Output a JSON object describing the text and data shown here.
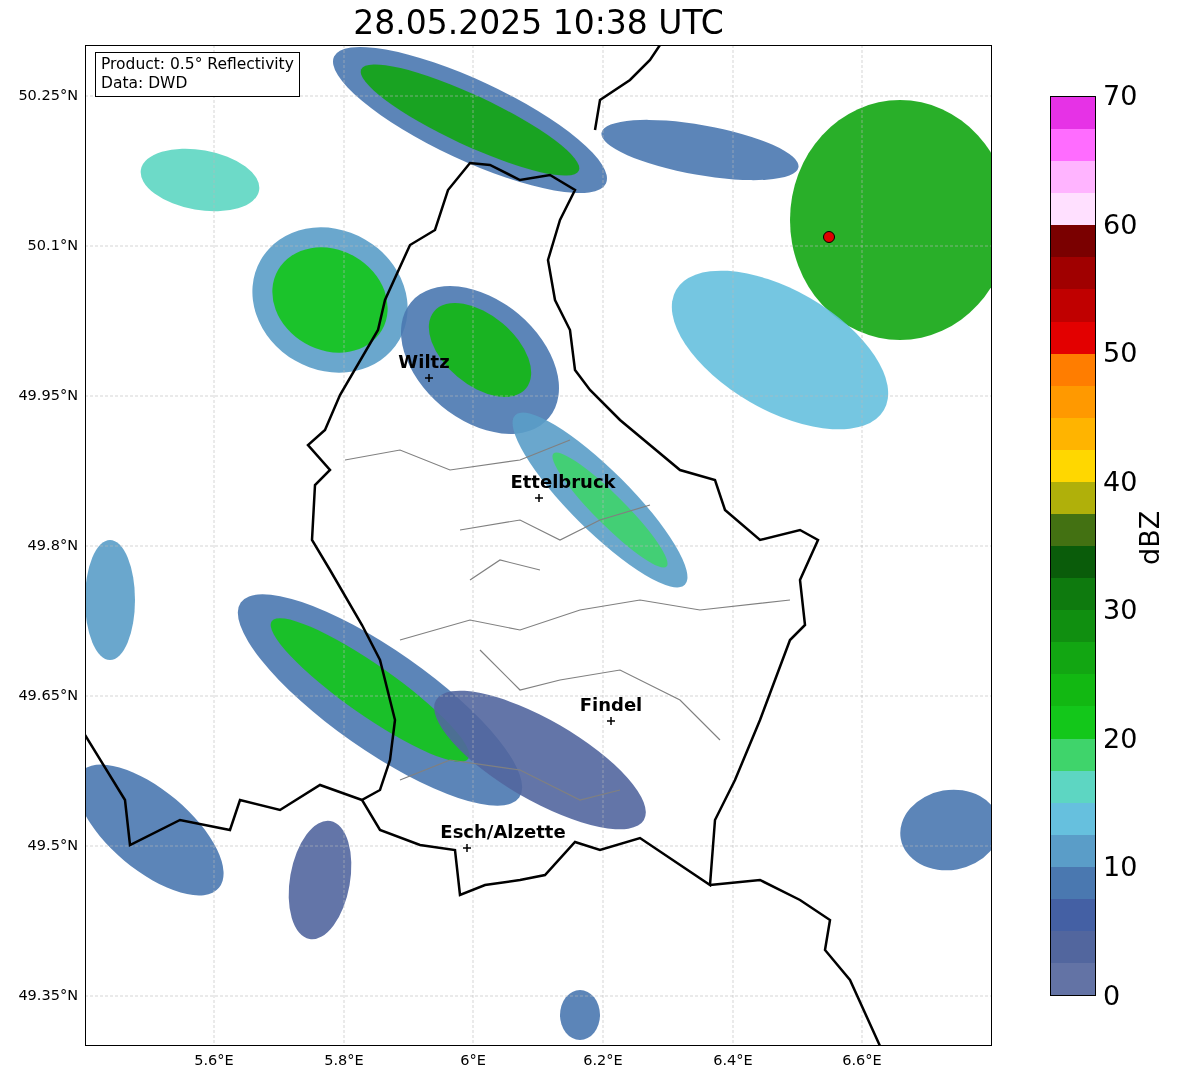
{
  "title": "28.05.2025 10:38 UTC",
  "info_box": [
    "Product: 0.5° Reflectivity",
    "Data: DWD"
  ],
  "map": {
    "y_ticks": [
      "50.25°N",
      "50.1°N",
      "49.95°N",
      "49.8°N",
      "49.65°N",
      "49.5°N",
      "49.35°N"
    ],
    "x_ticks": [
      "5.6°E",
      "5.8°E",
      "6°E",
      "6.2°E",
      "6.4°E",
      "6.6°E"
    ],
    "cities": [
      "Wiltz",
      "Ettelbruck",
      "Findel",
      "Esch/Alzette"
    ]
  },
  "colorbar": {
    "label": "dBZ",
    "ticks": [
      "70",
      "60",
      "50",
      "40",
      "30",
      "20",
      "10",
      "0"
    ],
    "bins": [
      {
        "color": "#e632e6"
      },
      {
        "color": "#ff6cff"
      },
      {
        "color": "#ffb4ff"
      },
      {
        "color": "#ffe0ff"
      },
      {
        "color": "#7a0000"
      },
      {
        "color": "#a00000"
      },
      {
        "color": "#c00000"
      },
      {
        "color": "#e30000"
      },
      {
        "color": "#ff7d00"
      },
      {
        "color": "#ff9900"
      },
      {
        "color": "#ffb400"
      },
      {
        "color": "#ffd700"
      },
      {
        "color": "#b0b00a"
      },
      {
        "color": "#437112"
      },
      {
        "color": "#0a5c0a"
      },
      {
        "color": "#0e7a0e"
      },
      {
        "color": "#108f10"
      },
      {
        "color": "#12a612"
      },
      {
        "color": "#12b812"
      },
      {
        "color": "#13c71a"
      },
      {
        "color": "#3fd46b"
      },
      {
        "color": "#5dd6c2"
      },
      {
        "color": "#66c0de"
      },
      {
        "color": "#5a9dc8"
      },
      {
        "color": "#4a78b0"
      },
      {
        "color": "#4460a4"
      },
      {
        "color": "#52669e"
      },
      {
        "color": "#6373a5"
      }
    ]
  }
}
